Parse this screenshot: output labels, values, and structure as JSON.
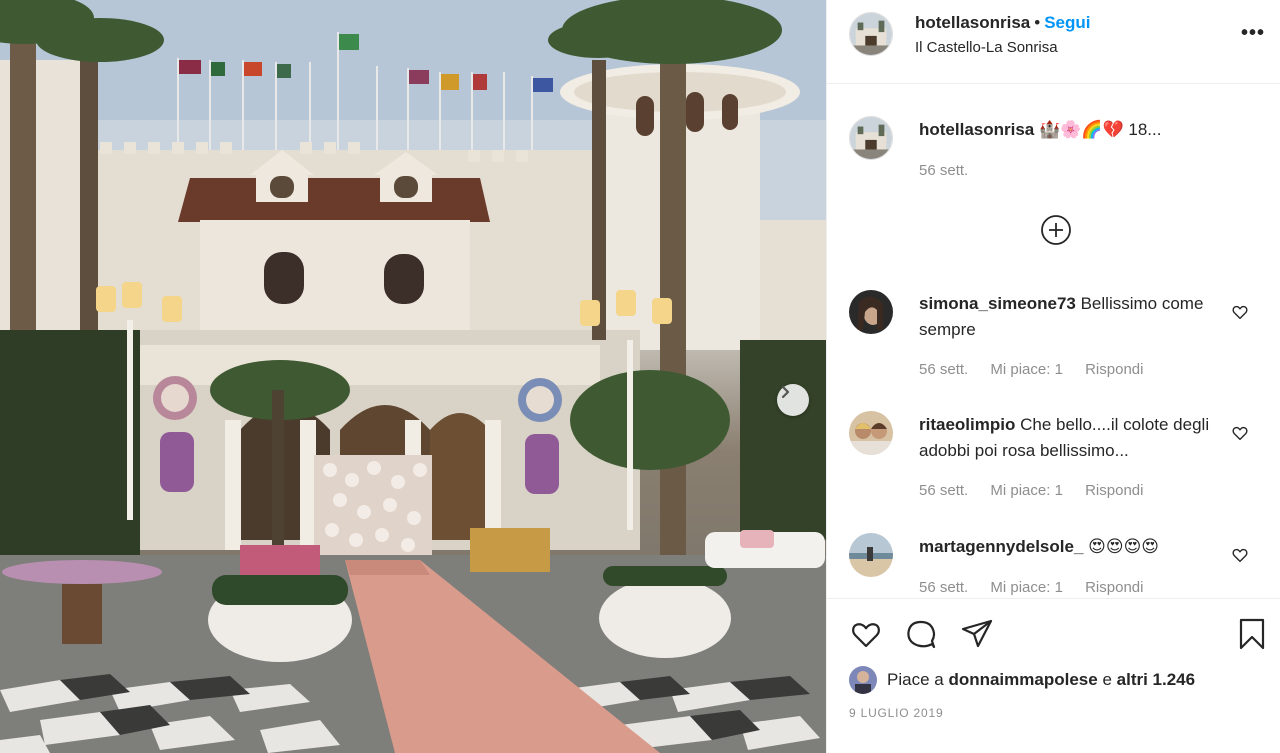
{
  "post": {
    "username": "hotellasonrisa",
    "separator": "•",
    "follow_label": "Segui",
    "location": "Il Castello-La Sonrisa",
    "more_label": "•••"
  },
  "caption": {
    "username": "hotellasonrisa",
    "text": "🏰🌸🌈💔 18...",
    "time": "56 sett."
  },
  "comments": [
    {
      "username": "simona_simeone73",
      "text": "Bellissimo come sempre",
      "time": "56 sett.",
      "likes": "Mi piace: 1",
      "reply": "Rispondi"
    },
    {
      "username": "ritaeolimpio",
      "text": "Che bello....il colote degli adobbi poi rosa bellissimo...",
      "time": "56 sett.",
      "likes": "Mi piace: 1",
      "reply": "Rispondi"
    },
    {
      "username": "martagennydelsole_",
      "text": "😍😍😍😍",
      "time": "56 sett.",
      "likes": "Mi piace: 1",
      "reply": "Rispondi"
    }
  ],
  "likes": {
    "prefix": "Piace a",
    "user": "donnaimmapolese",
    "middle": "e",
    "others": "altri 1.246"
  },
  "date": "9 LUGLIO 2019",
  "icons": {
    "heart": "heart-icon",
    "comment": "comment-icon",
    "share": "share-icon",
    "save": "bookmark-icon",
    "load_more": "plus-circle-icon",
    "next": "chevron-right-icon"
  }
}
